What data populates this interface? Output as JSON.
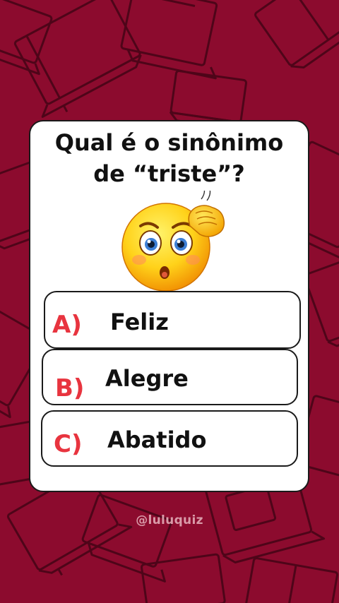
{
  "quiz": {
    "question_line1": "Qual é o sinônimo",
    "question_line2": "de “triste”?",
    "options": [
      {
        "letter": "A)",
        "text": "Feliz"
      },
      {
        "letter": "B)",
        "text": "Alegre"
      },
      {
        "letter": "C)",
        "text": "Abatido"
      }
    ]
  },
  "footer": {
    "handle": "@luluquiz"
  },
  "colors": {
    "background": "#8c0b2e",
    "card": "#ffffff",
    "letter_accent": "#e8343f",
    "text": "#111111"
  },
  "icons": {
    "emoji": "confused-thinking-face-icon",
    "background_pattern": "book-outline-pattern"
  }
}
